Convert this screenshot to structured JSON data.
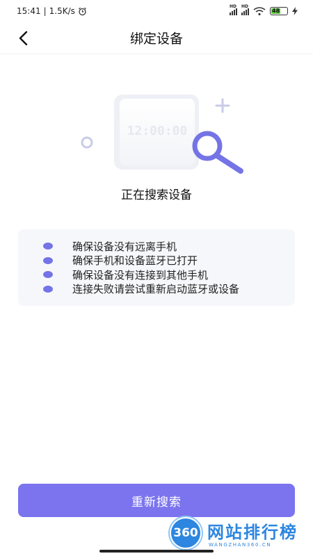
{
  "status_bar": {
    "time": "15:41",
    "speed": "1.5K/s",
    "alarm_icon": "alarm-icon",
    "signal_label": "HD",
    "battery": "48"
  },
  "header": {
    "title": "绑定设备",
    "back_icon": "chevron-left-icon"
  },
  "illustration": {
    "clock_text": "12:00:00",
    "accent_color": "#7474e6"
  },
  "status_text": "正在搜索设备",
  "tips": [
    "确保设备没有远离手机",
    "确保手机和设备蓝牙已打开",
    "确保设备没有连接到其他手机",
    "连接失败请尝试重新启动蓝牙或设备"
  ],
  "retry_button": "重新搜索",
  "watermark": {
    "logo": "360",
    "brand": "网站排行榜",
    "url": "WANGZHAN360.CN"
  }
}
